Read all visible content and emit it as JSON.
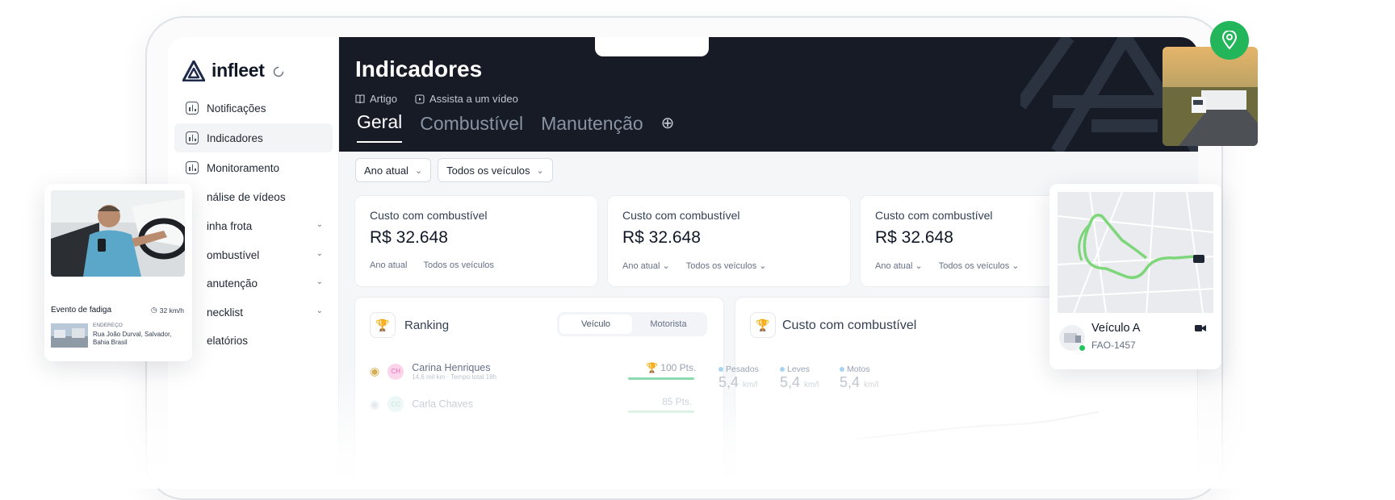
{
  "brand": {
    "name": "infleet"
  },
  "sidebar": {
    "items": [
      {
        "label": "Notificações"
      },
      {
        "label": "Indicadores"
      },
      {
        "label": "Monitoramento"
      },
      {
        "label": "nálise de vídeos"
      },
      {
        "label": "inha frota"
      },
      {
        "label": "ombustível"
      },
      {
        "label": "anutenção"
      },
      {
        "label": "necklist"
      },
      {
        "label": "elatórios"
      }
    ]
  },
  "header": {
    "title": "Indicadores",
    "link_article": "Artigo",
    "link_video": "Assista a um vídeo",
    "tabs": [
      {
        "label": "Geral"
      },
      {
        "label": "Combustível"
      },
      {
        "label": "Manutenção"
      }
    ]
  },
  "filters": {
    "period": "Ano atual",
    "vehicles": "Todos os veículos"
  },
  "cards": [
    {
      "label": "Custo com combustível",
      "value": "R$ 32.648",
      "period": "Ano atual",
      "vehicles": "Todos os veículos"
    },
    {
      "label": "Custo com combustível",
      "value": "R$ 32.648",
      "period": "Ano atual",
      "vehicles": "Todos os veículos"
    },
    {
      "label": "Custo com combustível",
      "value": "R$ 32.648",
      "period": "Ano atual",
      "vehicles": "Todos os veículos"
    }
  ],
  "ranking": {
    "title": "Ranking",
    "toggle": {
      "vehicle": "Veículo",
      "driver": "Motorista"
    },
    "rows": [
      {
        "initials": "CH",
        "name": "Carina Henriques",
        "meta": "14,6 mil km · Tempo total 18h",
        "points": "100 Pts."
      },
      {
        "initials": "CC",
        "name": "Carla Chaves",
        "meta": "",
        "points": "85 Pts."
      }
    ]
  },
  "fuel_panel": {
    "title": "Custo com combustível",
    "metrics": [
      {
        "label": "Pesados",
        "value": "5,4",
        "unit": "km/l"
      },
      {
        "label": "Leves",
        "value": "5,4",
        "unit": "km/l"
      },
      {
        "label": "Motos",
        "value": "5,4",
        "unit": "km/l"
      }
    ]
  },
  "fatigue_card": {
    "event": "Evento de fadiga",
    "speed": "32 km/h",
    "address_label": "ENDEREÇO",
    "address_line1": "Rua João Durval, Salvador,",
    "address_line2": "Bahia Brasil"
  },
  "vehicle_card": {
    "name": "Veículo A",
    "plate": "FAO-1457"
  },
  "colors": {
    "header_bg": "#161b26",
    "route_green": "#7ed67a",
    "pin_green": "#22b559",
    "status_green": "#22c55e"
  }
}
